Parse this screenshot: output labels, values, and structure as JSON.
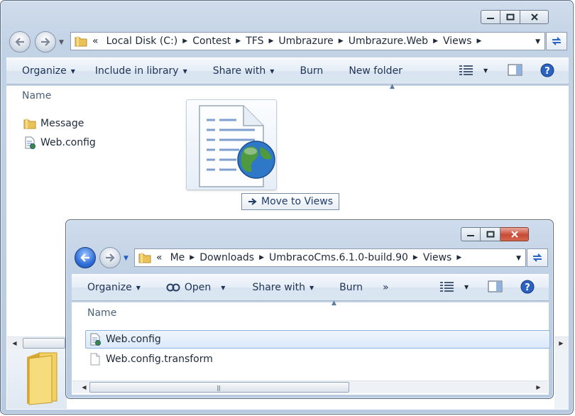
{
  "back_window": {
    "breadcrumb": [
      "Local Disk (C:)",
      "Contest",
      "TFS",
      "Umbrazure",
      "Umbrazure.Web",
      "Views"
    ],
    "toolbar": {
      "organize": "Organize",
      "include_in_library": "Include in library",
      "share_with": "Share with",
      "burn": "Burn",
      "new_folder": "New folder"
    },
    "column_header": "Name",
    "items": [
      {
        "name": "Message",
        "icon": "folder-icon"
      },
      {
        "name": "Web.config",
        "icon": "config-file-icon"
      }
    ]
  },
  "drag": {
    "tooltip": "Move to Views"
  },
  "front_window": {
    "breadcrumb": [
      "Me",
      "Downloads",
      "UmbracoCms.6.1.0-build.90",
      "Views"
    ],
    "toolbar": {
      "organize": "Organize",
      "open": "Open",
      "share_with": "Share with",
      "burn": "Burn",
      "more": "»"
    },
    "column_header": "Name",
    "items": [
      {
        "name": "Web.config",
        "icon": "config-file-icon",
        "selected": true
      },
      {
        "name": "Web.config.transform",
        "icon": "blank-file-icon",
        "selected": false
      }
    ]
  },
  "colors": {
    "frame": "#c3d3e6",
    "accent_blue": "#2f6ed8",
    "selection": "#dbe9fa",
    "close_red": "#c74a36"
  }
}
